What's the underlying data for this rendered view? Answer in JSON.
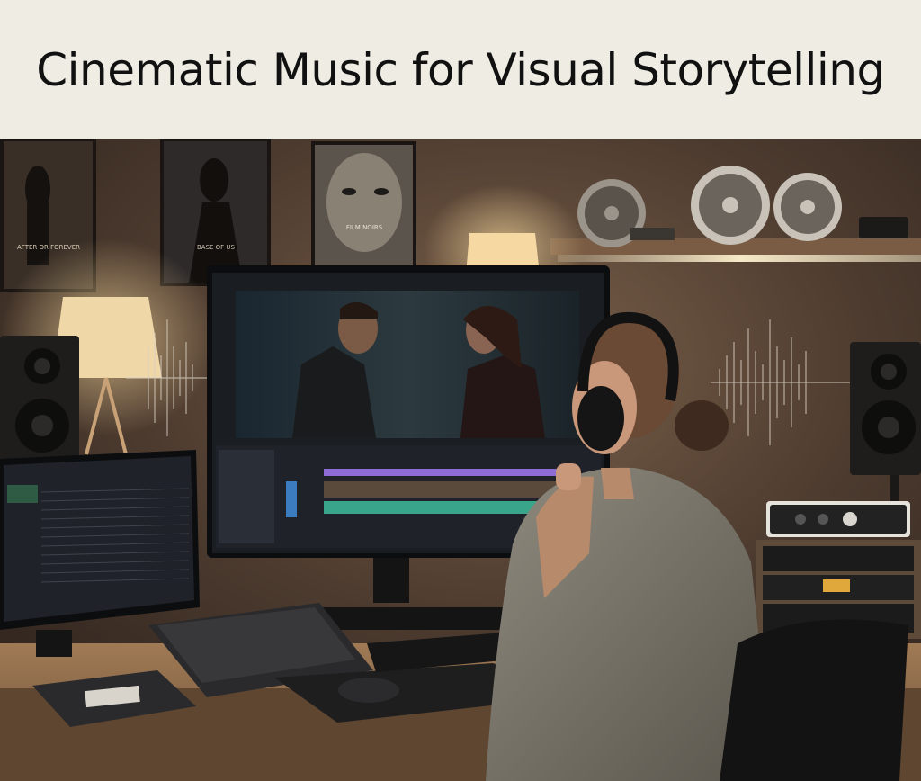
{
  "header": {
    "title": "Cinematic Music for Visual Storytelling"
  },
  "scene": {
    "poster_left_caption": "AFTER OR FOREVER",
    "poster_mid_caption": "BASE OF US",
    "poster_right_caption": "FILM NOIRS",
    "palette": {
      "wall": "#3a2e26",
      "wall_warm": "#6b5443",
      "desk": "#8a6a4c",
      "screen_dark": "#1a1d22",
      "timeline_accent": "#8f6bd6",
      "timeline_green": "#39a58a",
      "lamp_glow": "#f3d59a"
    }
  }
}
